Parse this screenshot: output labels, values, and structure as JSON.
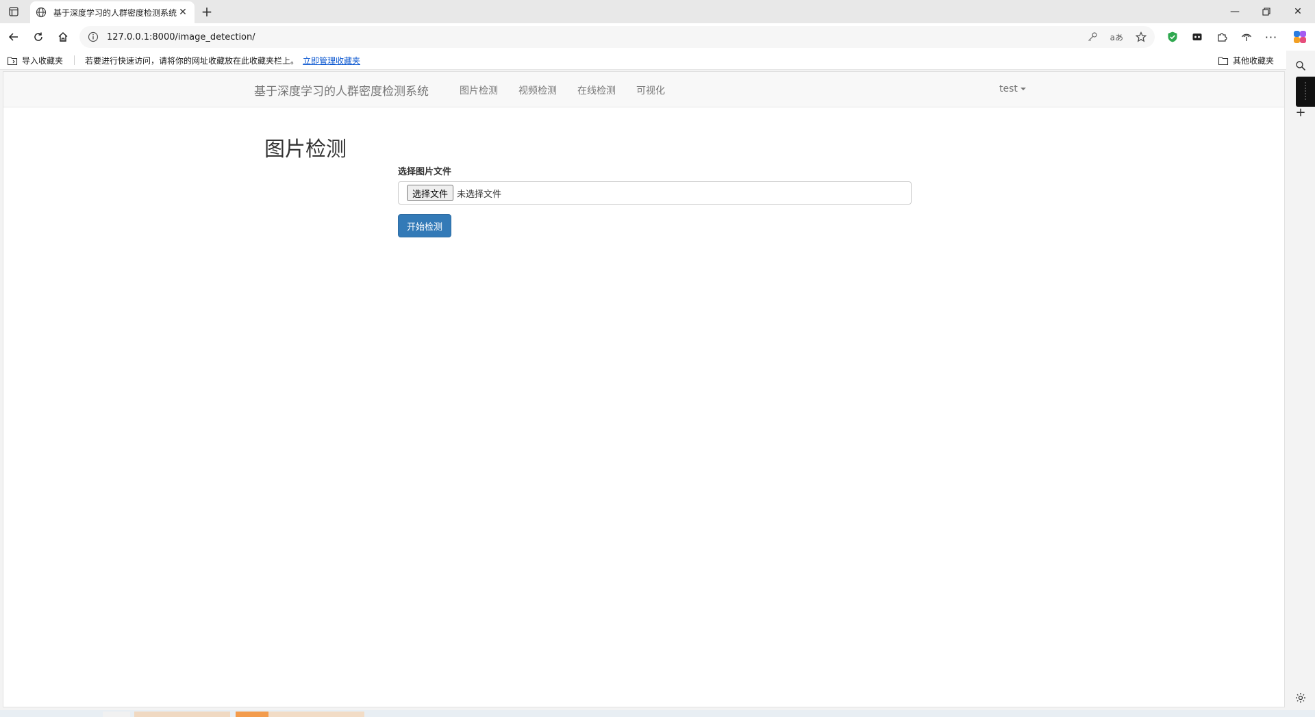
{
  "browser": {
    "tab_title": "基于深度学习的人群密度检测系统",
    "url": "127.0.0.1:8000/image_detection/",
    "favorites": {
      "import_label": "导入收藏夹",
      "hint": "若要进行快速访问，请将你的网址收藏放在此收藏夹栏上。",
      "manage_link": "立即管理收藏夹",
      "other_label": "其他收藏夹"
    }
  },
  "app": {
    "brand": "基于深度学习的人群密度检测系统",
    "nav": [
      "图片检测",
      "视频检测",
      "在线检测",
      "可视化"
    ],
    "user": "test"
  },
  "page": {
    "title": "图片检测",
    "file_label": "选择图片文件",
    "file_button": "选择文件",
    "file_status": "未选择文件",
    "submit": "开始检测"
  },
  "colors": {
    "primary_button": "#337ab7",
    "navbar_bg": "#f8f8f8",
    "link": "#0b57d0"
  }
}
